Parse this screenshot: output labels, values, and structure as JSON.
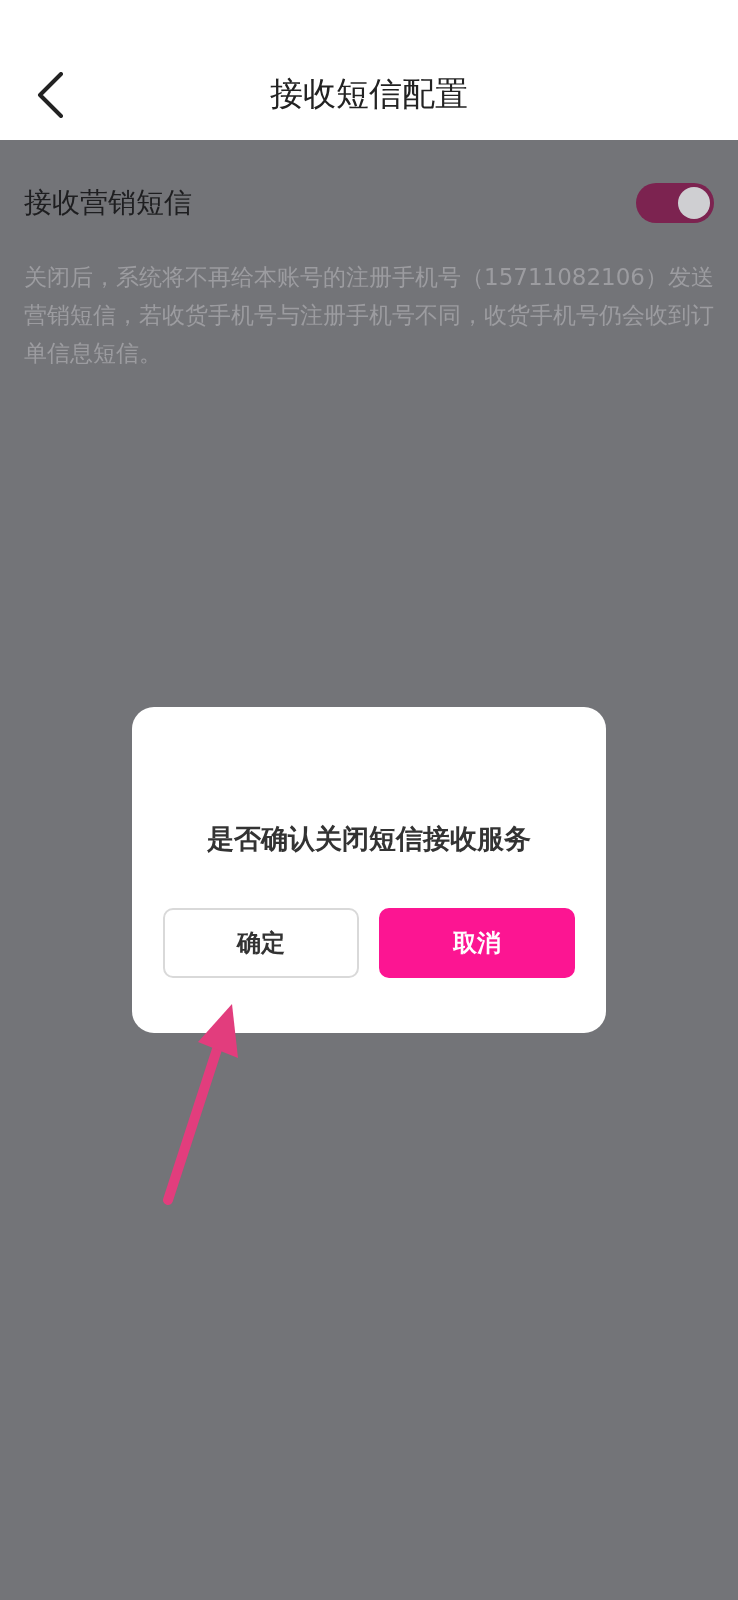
{
  "header": {
    "title": "接收短信配置"
  },
  "setting": {
    "label": "接收营销短信",
    "on": true,
    "description": "关闭后，系统将不再给本账号的注册手机号（15711082106）发送营销短信，若收货手机号与注册手机号不同，收货手机号仍会收到订单信息短信。"
  },
  "dialog": {
    "message": "是否确认关闭短信接收服务",
    "buttons": [
      {
        "label": "确定",
        "kind": "secondary"
      },
      {
        "label": "取消",
        "kind": "primary"
      }
    ]
  }
}
